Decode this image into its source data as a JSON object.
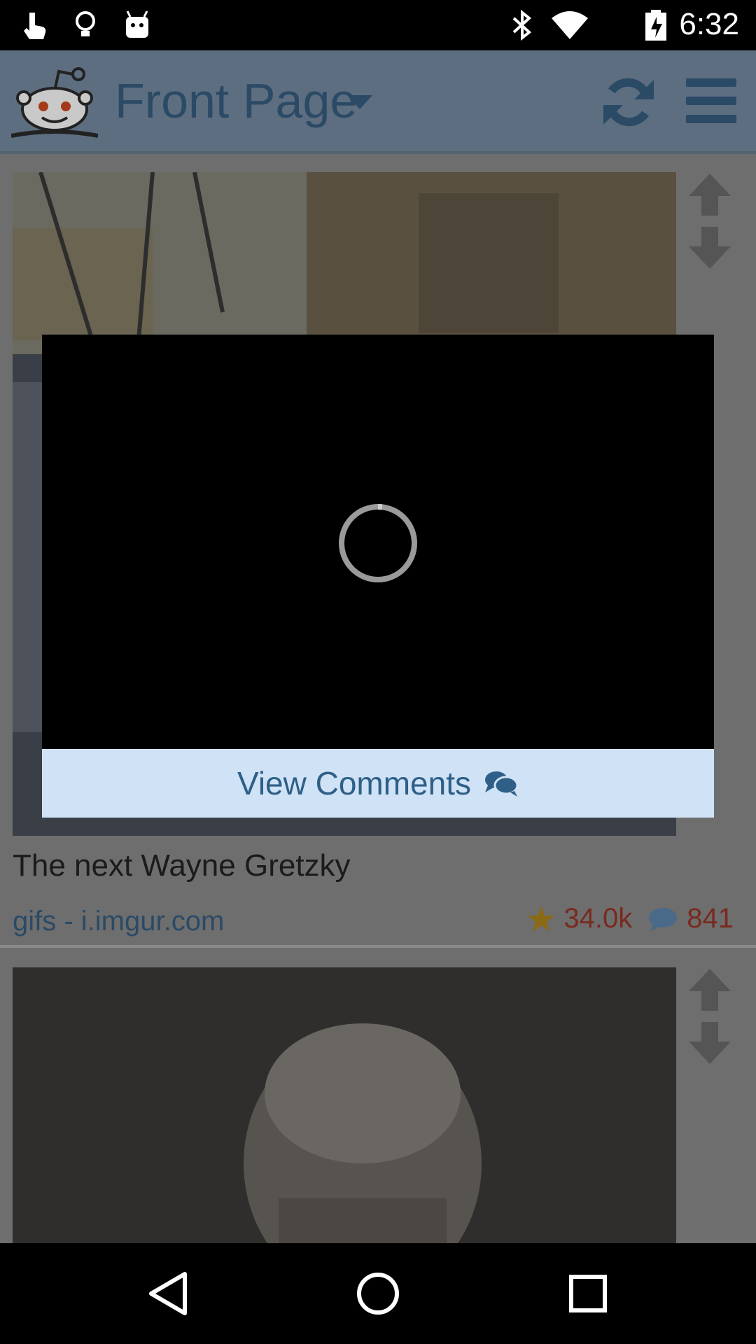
{
  "status_bar": {
    "time": "6:32",
    "left_icons": [
      "touch-icon",
      "lightbulb-icon",
      "android-icon"
    ],
    "right_icons": [
      "bluetooth-icon",
      "wifi-icon",
      "battery-charging-icon"
    ]
  },
  "header": {
    "title": "Front Page",
    "icons": [
      "reddit-alien-logo",
      "chevron-down-icon",
      "refresh-icon",
      "menu-icon"
    ]
  },
  "posts": [
    {
      "title": "The next Wayne Gretzky",
      "source": "gifs - i.imgur.com",
      "score": "34.0k",
      "comments": "841"
    },
    {
      "title": "",
      "source": "",
      "score": "",
      "comments": ""
    }
  ],
  "dialog": {
    "view_comments_label": "View Comments",
    "loading": true
  },
  "colors": {
    "accent": "#2e5f87",
    "score": "#7a2a1f",
    "dialog_footer_bg": "#cfe2f6"
  }
}
